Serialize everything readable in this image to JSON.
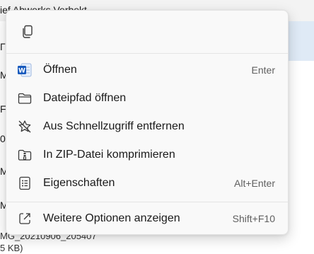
{
  "background": {
    "title_fragment": "ief Abwerks Verbekt",
    "left_fragments": [
      "Г",
      "MC",
      "FX",
      "02",
      "MC",
      "MC"
    ],
    "bottom_line1": "MG_20210906_205407",
    "bottom_line2": "5 KB)"
  },
  "quick_actions": [
    {
      "name": "copy",
      "icon": "copy-icon"
    }
  ],
  "menu": {
    "items": [
      {
        "label": "Öffnen",
        "shortcut": "Enter",
        "icon": "word-icon"
      },
      {
        "label": "Dateipfad öffnen",
        "shortcut": "",
        "icon": "folder-icon"
      },
      {
        "label": "Aus Schnellzugriff entfernen",
        "shortcut": "",
        "icon": "star-remove-icon"
      },
      {
        "label": "In ZIP-Datei komprimieren",
        "shortcut": "",
        "icon": "zip-icon"
      },
      {
        "label": "Eigenschaften",
        "shortcut": "Alt+Enter",
        "icon": "properties-icon"
      },
      {
        "label": "Weitere Optionen anzeigen",
        "shortcut": "Shift+F10",
        "icon": "open-external-icon"
      }
    ]
  },
  "colors": {
    "menu_bg": "#f9f9f9",
    "word_blue": "#185abd",
    "icon_stroke": "#3a3a3a",
    "shortcut_text": "#5f5f5f"
  }
}
